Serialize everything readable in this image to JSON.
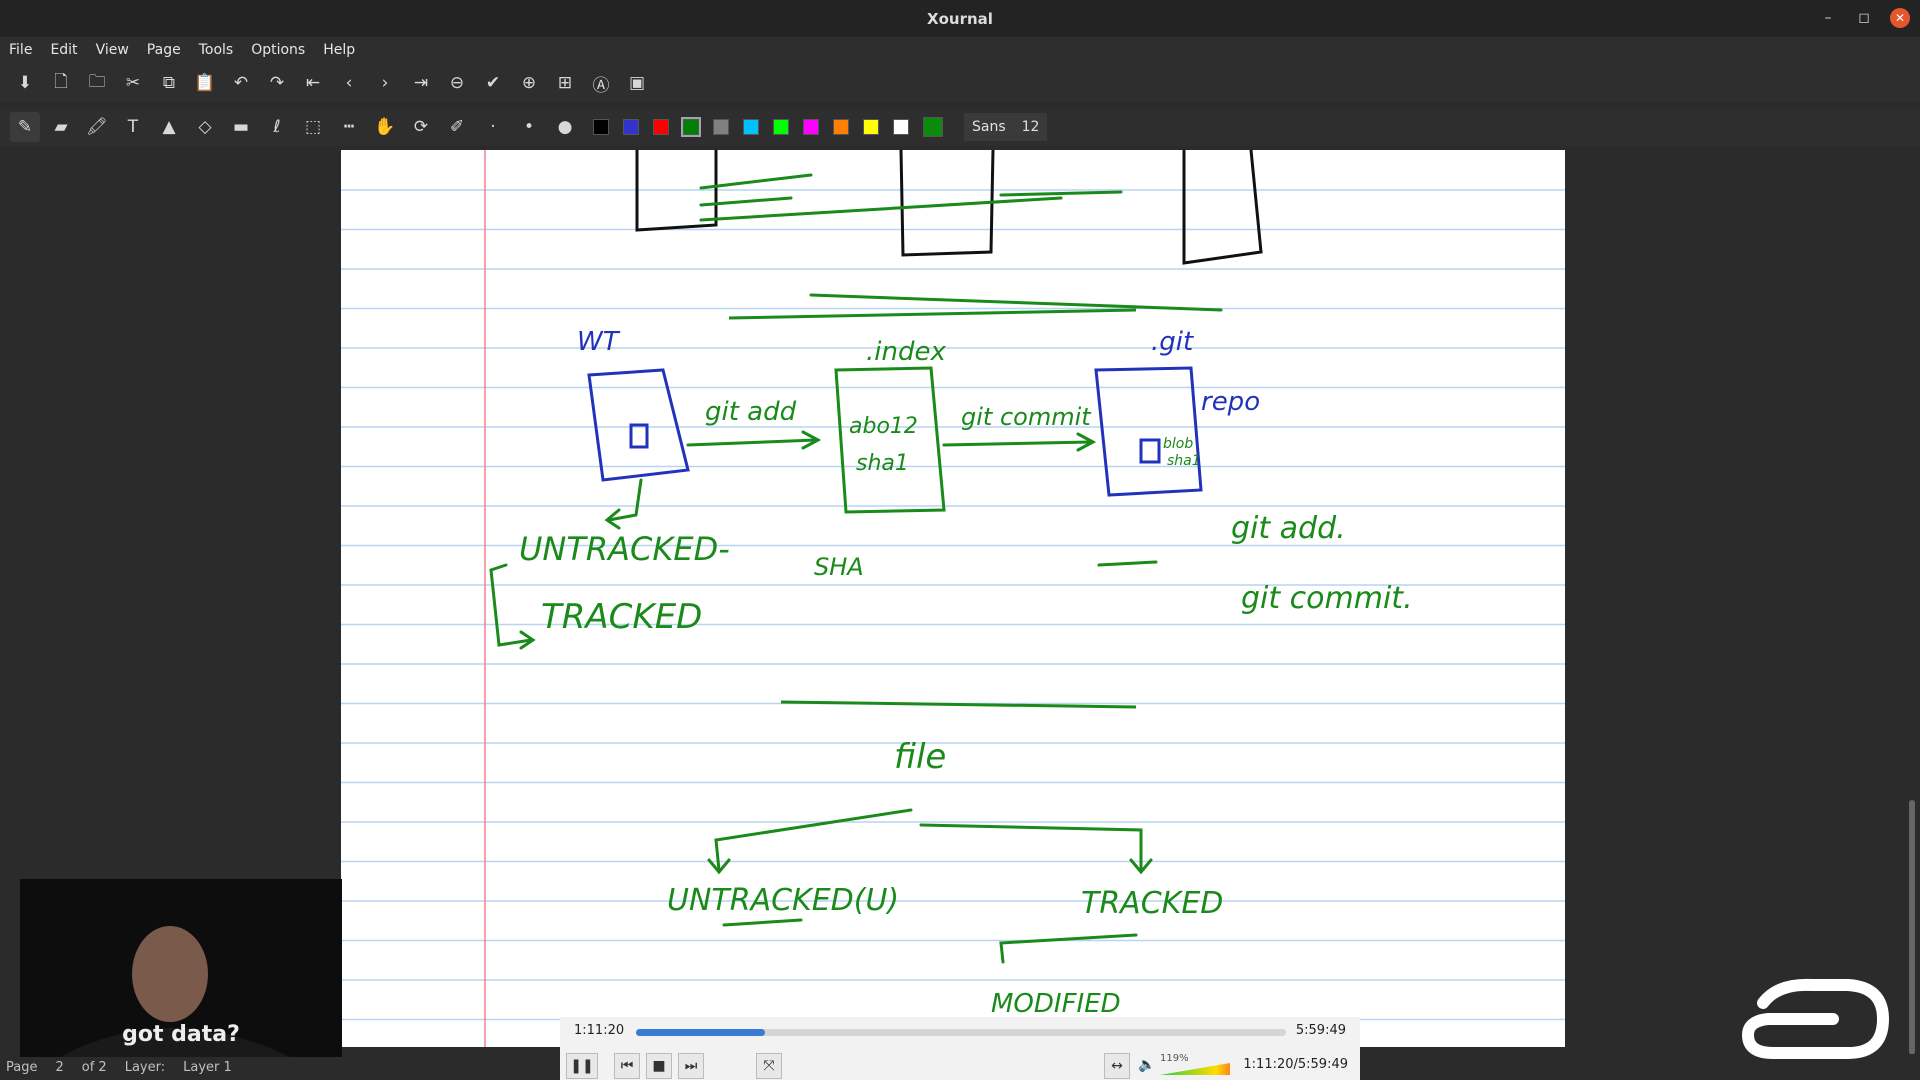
{
  "window": {
    "title": "Xournal"
  },
  "menu": [
    "File",
    "Edit",
    "View",
    "Page",
    "Tools",
    "Options",
    "Help"
  ],
  "toolbar1": [
    {
      "icon": "save-icon",
      "glyph": "⬇"
    },
    {
      "icon": "new-page-icon",
      "glyph": "🗋"
    },
    {
      "icon": "open-icon",
      "glyph": "🗀"
    },
    {
      "icon": "cut-icon",
      "glyph": "✂"
    },
    {
      "icon": "copy-icon",
      "glyph": "⧉"
    },
    {
      "icon": "paste-icon",
      "glyph": "📋"
    },
    {
      "icon": "undo-icon",
      "glyph": "↶"
    },
    {
      "icon": "redo-icon",
      "glyph": "↷"
    },
    {
      "icon": "first-page-icon",
      "glyph": "⇤"
    },
    {
      "icon": "prev-page-icon",
      "glyph": "‹"
    },
    {
      "icon": "next-page-icon",
      "glyph": "›"
    },
    {
      "icon": "last-page-icon",
      "glyph": "⇥"
    },
    {
      "icon": "zoom-out-icon",
      "glyph": "⊖"
    },
    {
      "icon": "zoom-fit-icon",
      "glyph": "✔"
    },
    {
      "icon": "zoom-in-icon",
      "glyph": "⊕"
    },
    {
      "icon": "page-width-icon",
      "glyph": "⊞"
    },
    {
      "icon": "zoom-set-icon",
      "glyph": "Ⓐ"
    },
    {
      "icon": "fullscreen-icon",
      "glyph": "▣"
    }
  ],
  "toolbar2": [
    {
      "icon": "pen-icon",
      "glyph": "✎",
      "active": true
    },
    {
      "icon": "eraser-icon",
      "glyph": "▰"
    },
    {
      "icon": "highlighter-icon",
      "glyph": "🖍"
    },
    {
      "icon": "text-icon",
      "glyph": "T"
    },
    {
      "icon": "image-icon",
      "glyph": "▲"
    },
    {
      "icon": "shape-recognizer-icon",
      "glyph": "◇"
    },
    {
      "icon": "ruler-icon",
      "glyph": "▬"
    },
    {
      "icon": "lasso-icon",
      "glyph": "ℓ"
    },
    {
      "icon": "rect-select-icon",
      "glyph": "⬚"
    },
    {
      "icon": "vertical-space-icon",
      "glyph": "┅"
    },
    {
      "icon": "hand-icon",
      "glyph": "✋"
    },
    {
      "icon": "default-tool-icon",
      "glyph": "⟳"
    },
    {
      "icon": "default-pen-icon",
      "glyph": "✐"
    },
    {
      "icon": "thickness-fine-icon",
      "glyph": "·"
    },
    {
      "icon": "thickness-medium-icon",
      "glyph": "•"
    },
    {
      "icon": "thickness-thick-icon",
      "glyph": "●"
    }
  ],
  "colors": [
    {
      "name": "black",
      "hex": "#000000"
    },
    {
      "name": "blue",
      "hex": "#3333cc"
    },
    {
      "name": "red",
      "hex": "#ff0000"
    },
    {
      "name": "green",
      "hex": "#008000",
      "selected": true
    },
    {
      "name": "gray",
      "hex": "#808080"
    },
    {
      "name": "light-blue",
      "hex": "#00c0ff"
    },
    {
      "name": "light-green",
      "hex": "#00ff00"
    },
    {
      "name": "magenta",
      "hex": "#ff00ff"
    },
    {
      "name": "orange",
      "hex": "#ff8000"
    },
    {
      "name": "yellow",
      "hex": "#ffff00"
    },
    {
      "name": "white",
      "hex": "#ffffff"
    }
  ],
  "current_color": "#0b8a0b",
  "font": {
    "name": "Sans",
    "size": "12"
  },
  "page": {
    "margin_color": "#f08090",
    "line_color": "#b8d4f0"
  },
  "notes": {
    "wt": "WT",
    "index": ".index",
    "git": ".git",
    "repo": "repo",
    "git_add_arrow": "git add",
    "git_commit_arrow": "git commit",
    "abo12": "abo12",
    "sha1": "sha1",
    "blob": "blob",
    "sha1_small": "sha1",
    "untracked": "UNTRACKED-",
    "tracked": "TRACKED",
    "sha": "SHA",
    "git_add": "git add.",
    "git_commit": "git commit.",
    "file": "file",
    "untracked_u": "UNTRACKED(U)",
    "tracked2": "TRACKED",
    "modified": "MODIFIED"
  },
  "webcam": {
    "caption": "got data?"
  },
  "status": {
    "page_label": "Page",
    "page_num": "2",
    "of": "of 2",
    "layer_label": "Layer:",
    "layer": "Layer 1"
  },
  "player": {
    "elapsed": "1:11:20",
    "total": "5:59:49",
    "position": "1:11:20/5:59:49",
    "progress": 0.198,
    "volume": "119%"
  }
}
